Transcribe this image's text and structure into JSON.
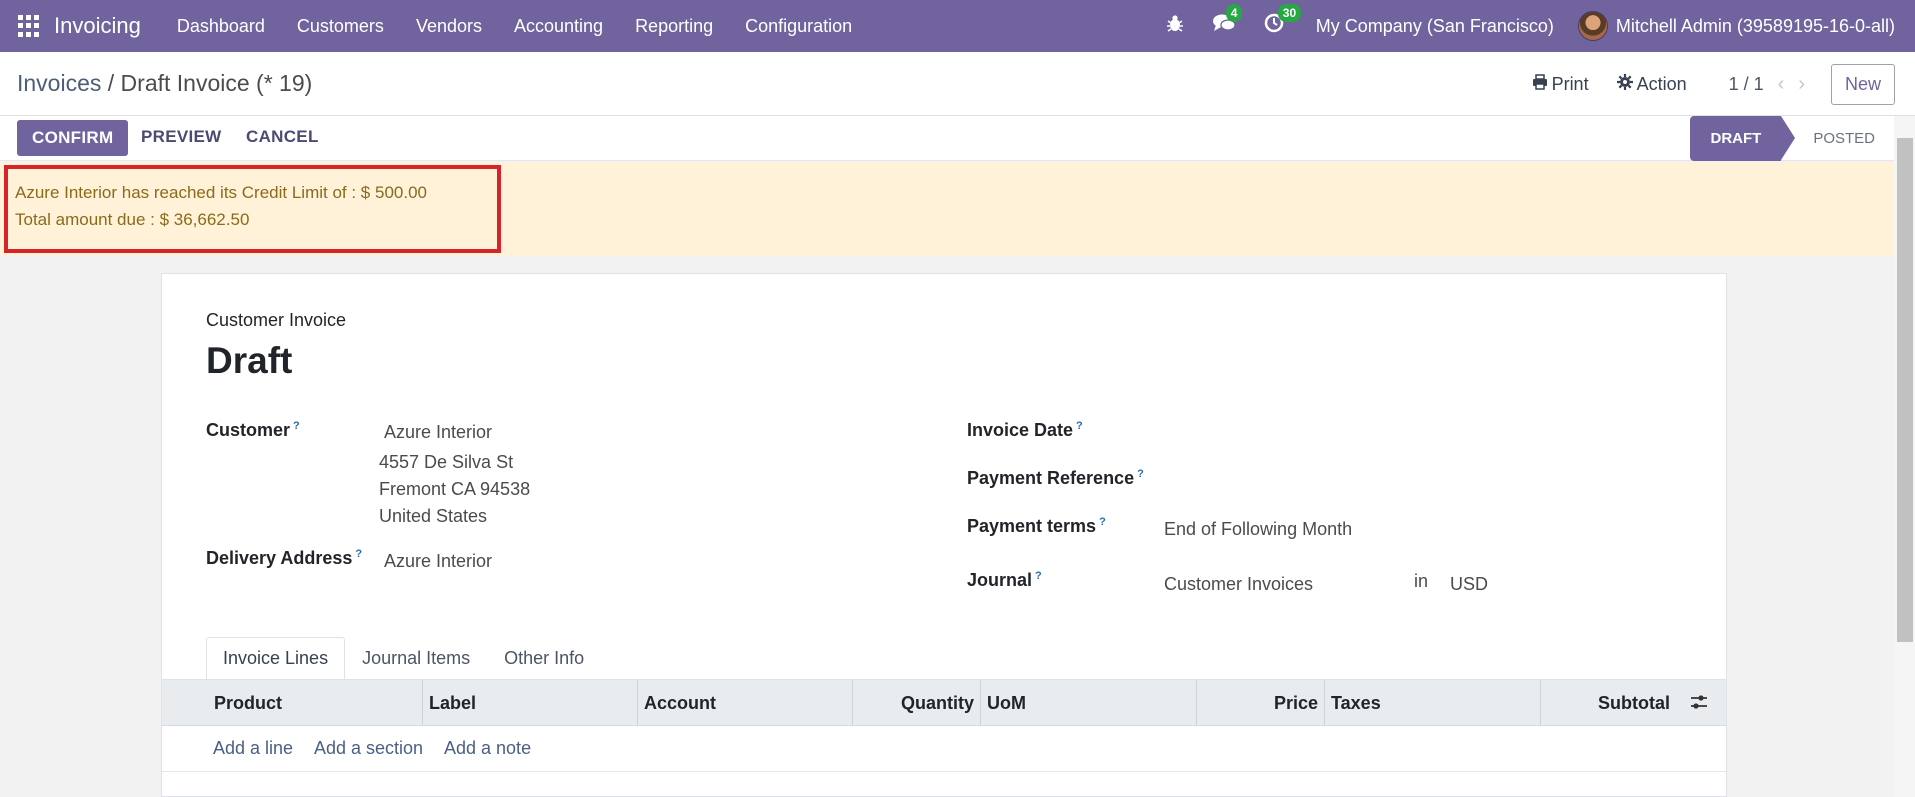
{
  "app": {
    "name": "Invoicing",
    "menu": [
      "Dashboard",
      "Customers",
      "Vendors",
      "Accounting",
      "Reporting",
      "Configuration"
    ],
    "messages_count": "4",
    "activities_count": "30",
    "company": "My Company (San Francisco)",
    "user": "Mitchell Admin (39589195-16-0-all)"
  },
  "breadcrumb": {
    "parent": "Invoices",
    "separator": "/",
    "current": "Draft Invoice (* 19)"
  },
  "control": {
    "print_label": "Print",
    "action_label": "Action",
    "pager": "1 / 1",
    "new_label": "New"
  },
  "statusbar": {
    "confirm_label": "CONFIRM",
    "preview_label": "PREVIEW",
    "cancel_label": "CANCEL",
    "stage_draft": "DRAFT",
    "stage_posted": "POSTED"
  },
  "warning": {
    "line1": "Azure Interior has reached its Credit Limit of : $ 500.00",
    "line2": "Total amount due : $ 36,662.50"
  },
  "form": {
    "doc_type": "Customer Invoice",
    "doc_name": "Draft",
    "help_mark": "?",
    "customer_label": "Customer",
    "customer_value": "Azure Interior",
    "address_line1": "4557 De Silva St",
    "address_line2": "Fremont CA 94538",
    "address_line3": "United States",
    "delivery_label": "Delivery Address",
    "delivery_value": "Azure Interior",
    "invoice_date_label": "Invoice Date",
    "payment_ref_label": "Payment Reference",
    "payment_terms_label": "Payment terms",
    "payment_terms_value": "End of Following Month",
    "journal_label": "Journal",
    "journal_value": "Customer Invoices",
    "in_label": "in",
    "currency_value": "USD"
  },
  "tabs": [
    "Invoice Lines",
    "Journal Items",
    "Other Info"
  ],
  "table": {
    "columns": [
      "Product",
      "Label",
      "Account",
      "Quantity",
      "UoM",
      "Price",
      "Taxes",
      "Subtotal"
    ],
    "add_line": "Add a line",
    "add_section": "Add a section",
    "add_note": "Add a note"
  }
}
